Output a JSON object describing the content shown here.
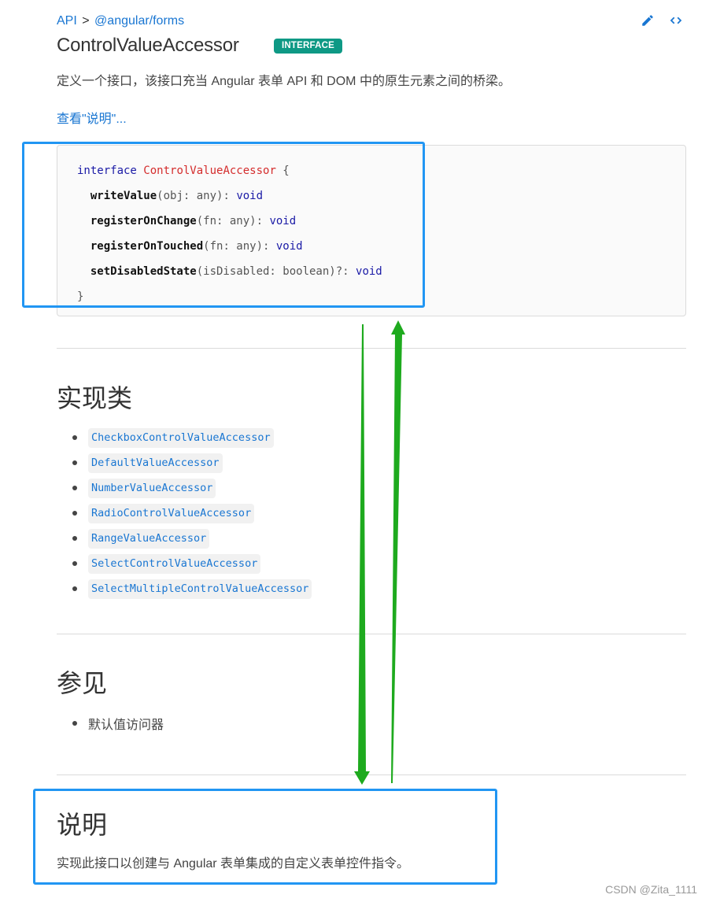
{
  "breadcrumb": {
    "items": [
      "API",
      "@angular/forms"
    ],
    "separator": ">"
  },
  "toolbar": {
    "edit_icon": "pencil-icon",
    "source_icon": "code-brackets-icon"
  },
  "header": {
    "title": "ControlValueAccessor",
    "badge": "INTERFACE",
    "badge_color": "#0e9985"
  },
  "description": "定义一个接口，该接口充当 Angular 表单 API 和 DOM 中的原生元素之间的桥梁。",
  "see_more_link": "查看\"说明\"...",
  "code": {
    "keyword": "interface",
    "type_name": "ControlValueAccessor",
    "open_brace": " {",
    "close_brace": "}",
    "methods": [
      {
        "name": "writeValue",
        "params": "(obj: any): ",
        "return": "void"
      },
      {
        "name": "registerOnChange",
        "params": "(fn: any): ",
        "return": "void"
      },
      {
        "name": "registerOnTouched",
        "params": "(fn: any): ",
        "return": "void"
      },
      {
        "name": "setDisabledState",
        "params": "(isDisabled: boolean)?: ",
        "return": "void"
      }
    ]
  },
  "implementations": {
    "heading": "实现类",
    "items": [
      "CheckboxControlValueAccessor",
      "DefaultValueAccessor",
      "NumberValueAccessor",
      "RadioControlValueAccessor",
      "RangeValueAccessor",
      "SelectControlValueAccessor",
      "SelectMultipleControlValueAccessor"
    ]
  },
  "see_also": {
    "heading": "参见",
    "items": [
      "默认值访问器"
    ]
  },
  "explanation": {
    "heading": "说明",
    "text": "实现此接口以创建与 Angular 表单集成的自定义表单控件指令。"
  },
  "annotations": {
    "highlight_color": "#2196f3",
    "arrow_color": "#1eaa1e"
  },
  "watermark": "CSDN @Zita_1111"
}
